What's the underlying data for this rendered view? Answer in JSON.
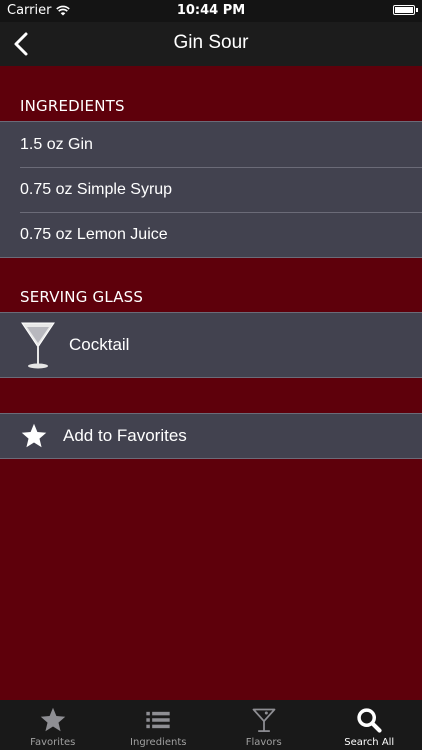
{
  "status_bar": {
    "carrier": "Carrier",
    "time": "10:44 PM"
  },
  "nav": {
    "title": "Gin Sour"
  },
  "sections": {
    "ingredients": {
      "header": "INGREDIENTS",
      "items": [
        "1.5 oz Gin",
        "0.75 oz Simple Syrup",
        "0.75 oz Lemon Juice"
      ]
    },
    "serving_glass": {
      "header": "SERVING GLASS",
      "glass": "Cocktail"
    },
    "favorites": {
      "label": "Add to Favorites"
    }
  },
  "tab_bar": {
    "tabs": [
      {
        "label": "Favorites",
        "icon": "star-icon"
      },
      {
        "label": "Ingredients",
        "icon": "list-icon"
      },
      {
        "label": "Flavors",
        "icon": "martini-glass-icon"
      },
      {
        "label": "Search All",
        "icon": "search-icon"
      }
    ],
    "active_tab": "Search All"
  }
}
